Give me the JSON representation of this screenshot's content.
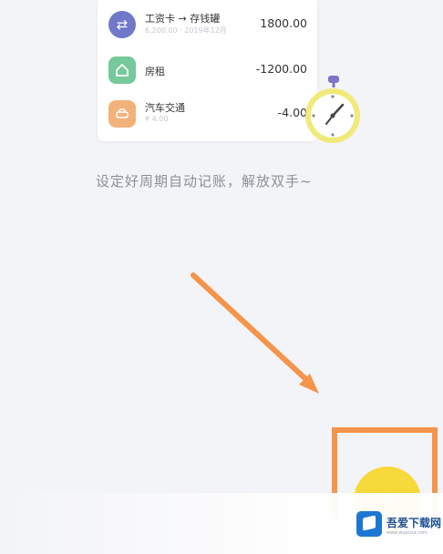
{
  "transactions": [
    {
      "title": "工资卡 → 存钱罐",
      "subtitle": "6,200.00 · 2019年12月",
      "amount": "1800.00",
      "icon": "transfer-icon",
      "color": "#6f78c9"
    },
    {
      "title": "房租",
      "subtitle": "",
      "amount": "-1200.00",
      "icon": "house-icon",
      "color": "#75c99a"
    },
    {
      "title": "汽车交通",
      "subtitle": "¥ 4.00",
      "amount": "-4.00",
      "icon": "car-icon",
      "color": "#f2b27a"
    }
  ],
  "caption": "设定好周期自动记账，解放双手~",
  "watermark": {
    "name": "吾爱下载网",
    "url": "www.wuaixia.com"
  },
  "colors": {
    "background": "#f3f4f8",
    "highlight": "#f5944b",
    "fab": "#f6d93a",
    "stopwatch_ring": "#f0ea7a",
    "stopwatch_button": "#7b74c9"
  }
}
